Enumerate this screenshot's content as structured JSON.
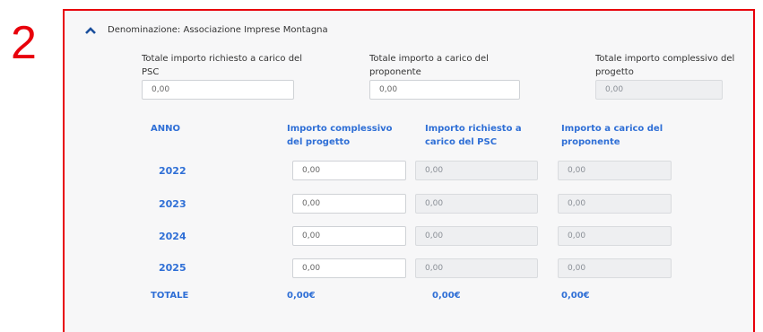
{
  "step_number": "2",
  "header": {
    "label": "Denominazione: Associazione Imprese Montagna"
  },
  "totals": [
    {
      "label": "Totale importo richiesto a carico del PSC",
      "value": "0,00"
    },
    {
      "label": "Totale importo a carico del proponente",
      "value": "0,00"
    },
    {
      "label": "Totale importo complessivo del progetto",
      "value": "0,00"
    }
  ],
  "table": {
    "headers": [
      "ANNO",
      "Importo complessivo del progetto",
      "Importo richiesto a carico del PSC",
      "Importo a carico del proponente"
    ],
    "rows": [
      {
        "year": "2022",
        "complessivo": "0,00",
        "psc": "0,00",
        "proponente": "0,00"
      },
      {
        "year": "2023",
        "complessivo": "0,00",
        "psc": "0,00",
        "proponente": "0,00"
      },
      {
        "year": "2024",
        "complessivo": "0,00",
        "psc": "0,00",
        "proponente": "0,00"
      },
      {
        "year": "2025",
        "complessivo": "0,00",
        "psc": "0,00",
        "proponente": "0,00"
      }
    ],
    "total_row": {
      "label": "TOTALE",
      "complessivo": "0,00€",
      "psc": "0,00€",
      "proponente": "0,00€"
    }
  },
  "icons": {
    "collapse": "chevron-up-icon"
  },
  "colors": {
    "accent": "#2f6fd6",
    "highlight_border": "#e8000b"
  }
}
